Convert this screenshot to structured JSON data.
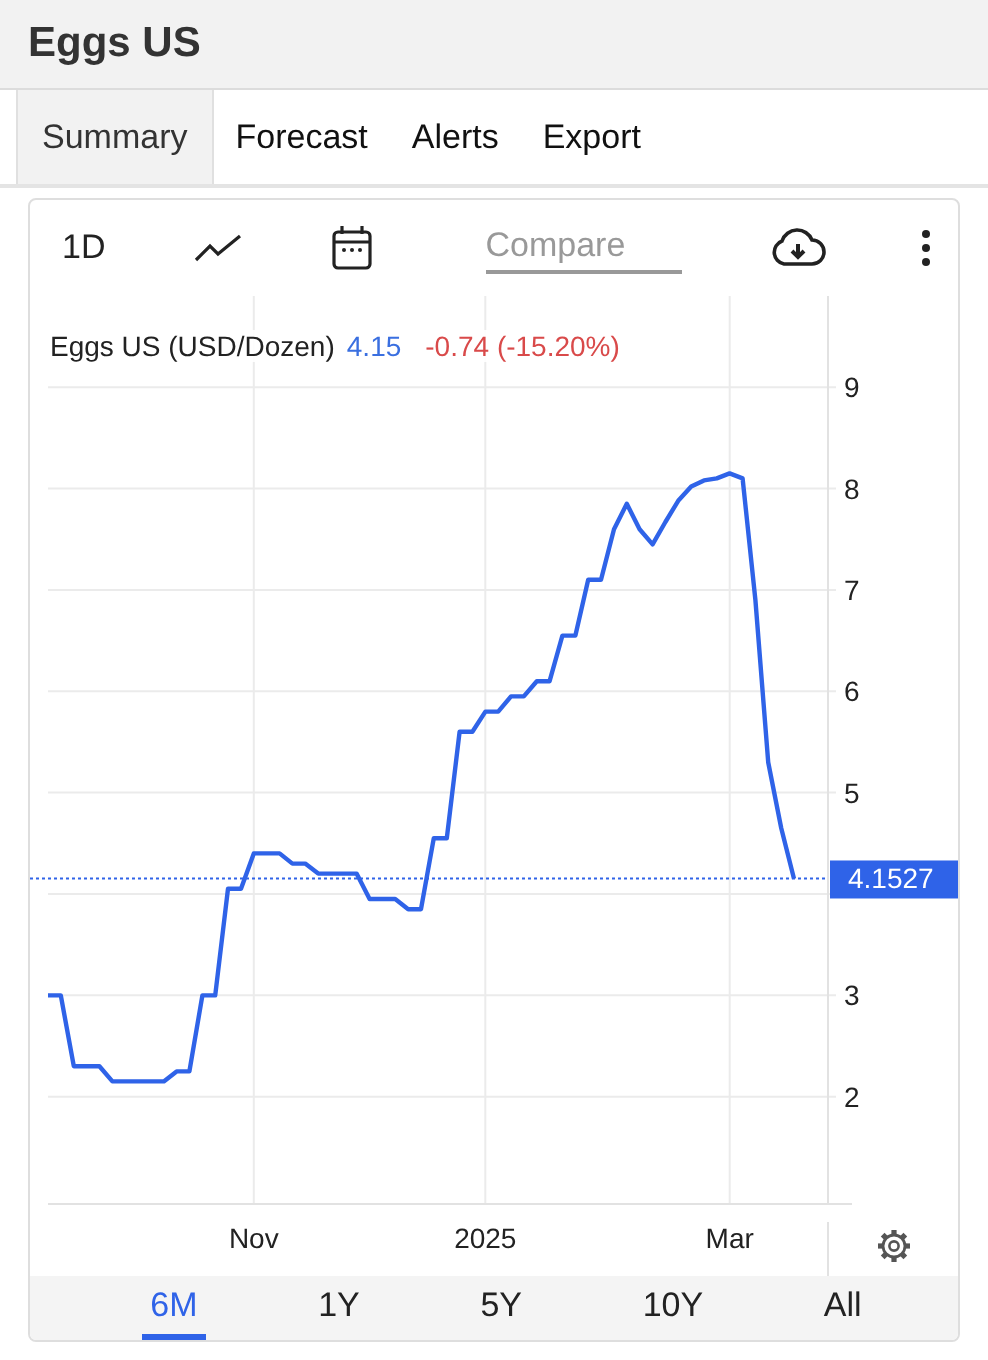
{
  "header": {
    "title": "Eggs US"
  },
  "tabs": [
    {
      "label": "Summary",
      "selected": true
    },
    {
      "label": "Forecast",
      "selected": false
    },
    {
      "label": "Alerts",
      "selected": false
    },
    {
      "label": "Export",
      "selected": false
    }
  ],
  "toolbar": {
    "interval": "1D",
    "compare": {
      "placeholder": "Compare"
    }
  },
  "chart": {
    "legend": {
      "price": "4.15",
      "change": "-0.74 (-15.20%)"
    },
    "last_price": "4.1527",
    "chart_data": {
      "type": "line",
      "grid": true,
      "ylim": [
        1,
        9.9
      ],
      "ref_lines": [
        {
          "axis": "y",
          "value": 4.1527,
          "color": "#2f63e8"
        }
      ],
      "yticks": [
        2,
        3,
        5,
        6,
        7,
        8,
        9
      ],
      "categories": [
        null,
        null,
        null,
        null,
        null,
        null,
        null,
        null,
        null,
        null,
        null,
        null,
        null,
        null,
        null,
        null,
        "Nov",
        null,
        null,
        null,
        null,
        null,
        null,
        null,
        null,
        null,
        null,
        null,
        null,
        null,
        null,
        null,
        null,
        null,
        "2025",
        null,
        null,
        null,
        null,
        null,
        null,
        null,
        null,
        null,
        null,
        null,
        null,
        null,
        null,
        null,
        null,
        null,
        null,
        "Mar",
        null,
        null,
        null,
        null,
        null
      ],
      "series": [
        {
          "name": "Eggs US (USD/Dozen)",
          "color": "#2f63e8",
          "values": [
            3.0,
            3.0,
            2.3,
            2.3,
            2.3,
            2.15,
            2.15,
            2.15,
            2.15,
            2.15,
            2.25,
            2.25,
            3.0,
            3.0,
            4.05,
            4.05,
            4.4,
            4.4,
            4.4,
            4.3,
            4.3,
            4.2,
            4.2,
            4.2,
            4.2,
            3.95,
            3.95,
            3.95,
            3.85,
            3.85,
            4.55,
            4.55,
            5.6,
            5.6,
            5.8,
            5.8,
            5.95,
            5.95,
            6.1,
            6.1,
            6.55,
            6.55,
            7.1,
            7.1,
            7.6,
            7.85,
            7.6,
            7.45,
            7.67,
            7.88,
            8.02,
            8.08,
            8.1,
            8.15,
            8.1,
            6.9,
            5.3,
            4.65,
            4.15
          ]
        }
      ]
    }
  },
  "ranges": [
    {
      "label": "6M",
      "selected": true
    },
    {
      "label": "1Y",
      "selected": false
    },
    {
      "label": "5Y",
      "selected": false
    },
    {
      "label": "10Y",
      "selected": false
    },
    {
      "label": "All",
      "selected": false
    }
  ]
}
